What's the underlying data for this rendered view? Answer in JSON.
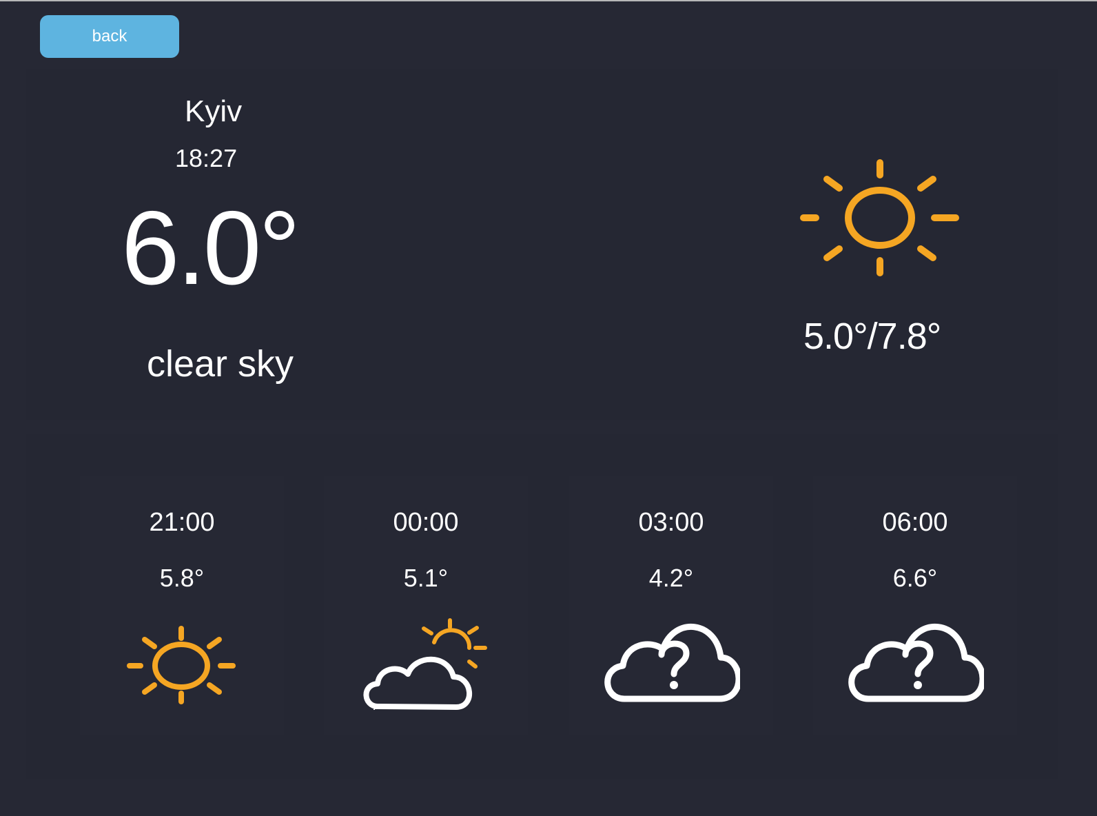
{
  "nav": {
    "back_label": "back"
  },
  "current": {
    "city": "Kyiv",
    "time": "18:27",
    "temperature": "6.0°",
    "description": "clear sky",
    "range": "5.0°/7.8°",
    "icon": "sun-icon"
  },
  "forecast": [
    {
      "time": "21:00",
      "temperature": "5.8°",
      "icon": "sun-icon"
    },
    {
      "time": "00:00",
      "temperature": "5.1°",
      "icon": "partly-cloudy-icon"
    },
    {
      "time": "03:00",
      "temperature": "4.2°",
      "icon": "unknown-weather-cloud-icon"
    },
    {
      "time": "06:00",
      "temperature": "6.6°",
      "icon": "unknown-weather-cloud-icon"
    }
  ],
  "colors": {
    "background": "#262834",
    "accent_button": "#5eb4e0",
    "sun": "#f5a623",
    "text": "#ffffff"
  }
}
